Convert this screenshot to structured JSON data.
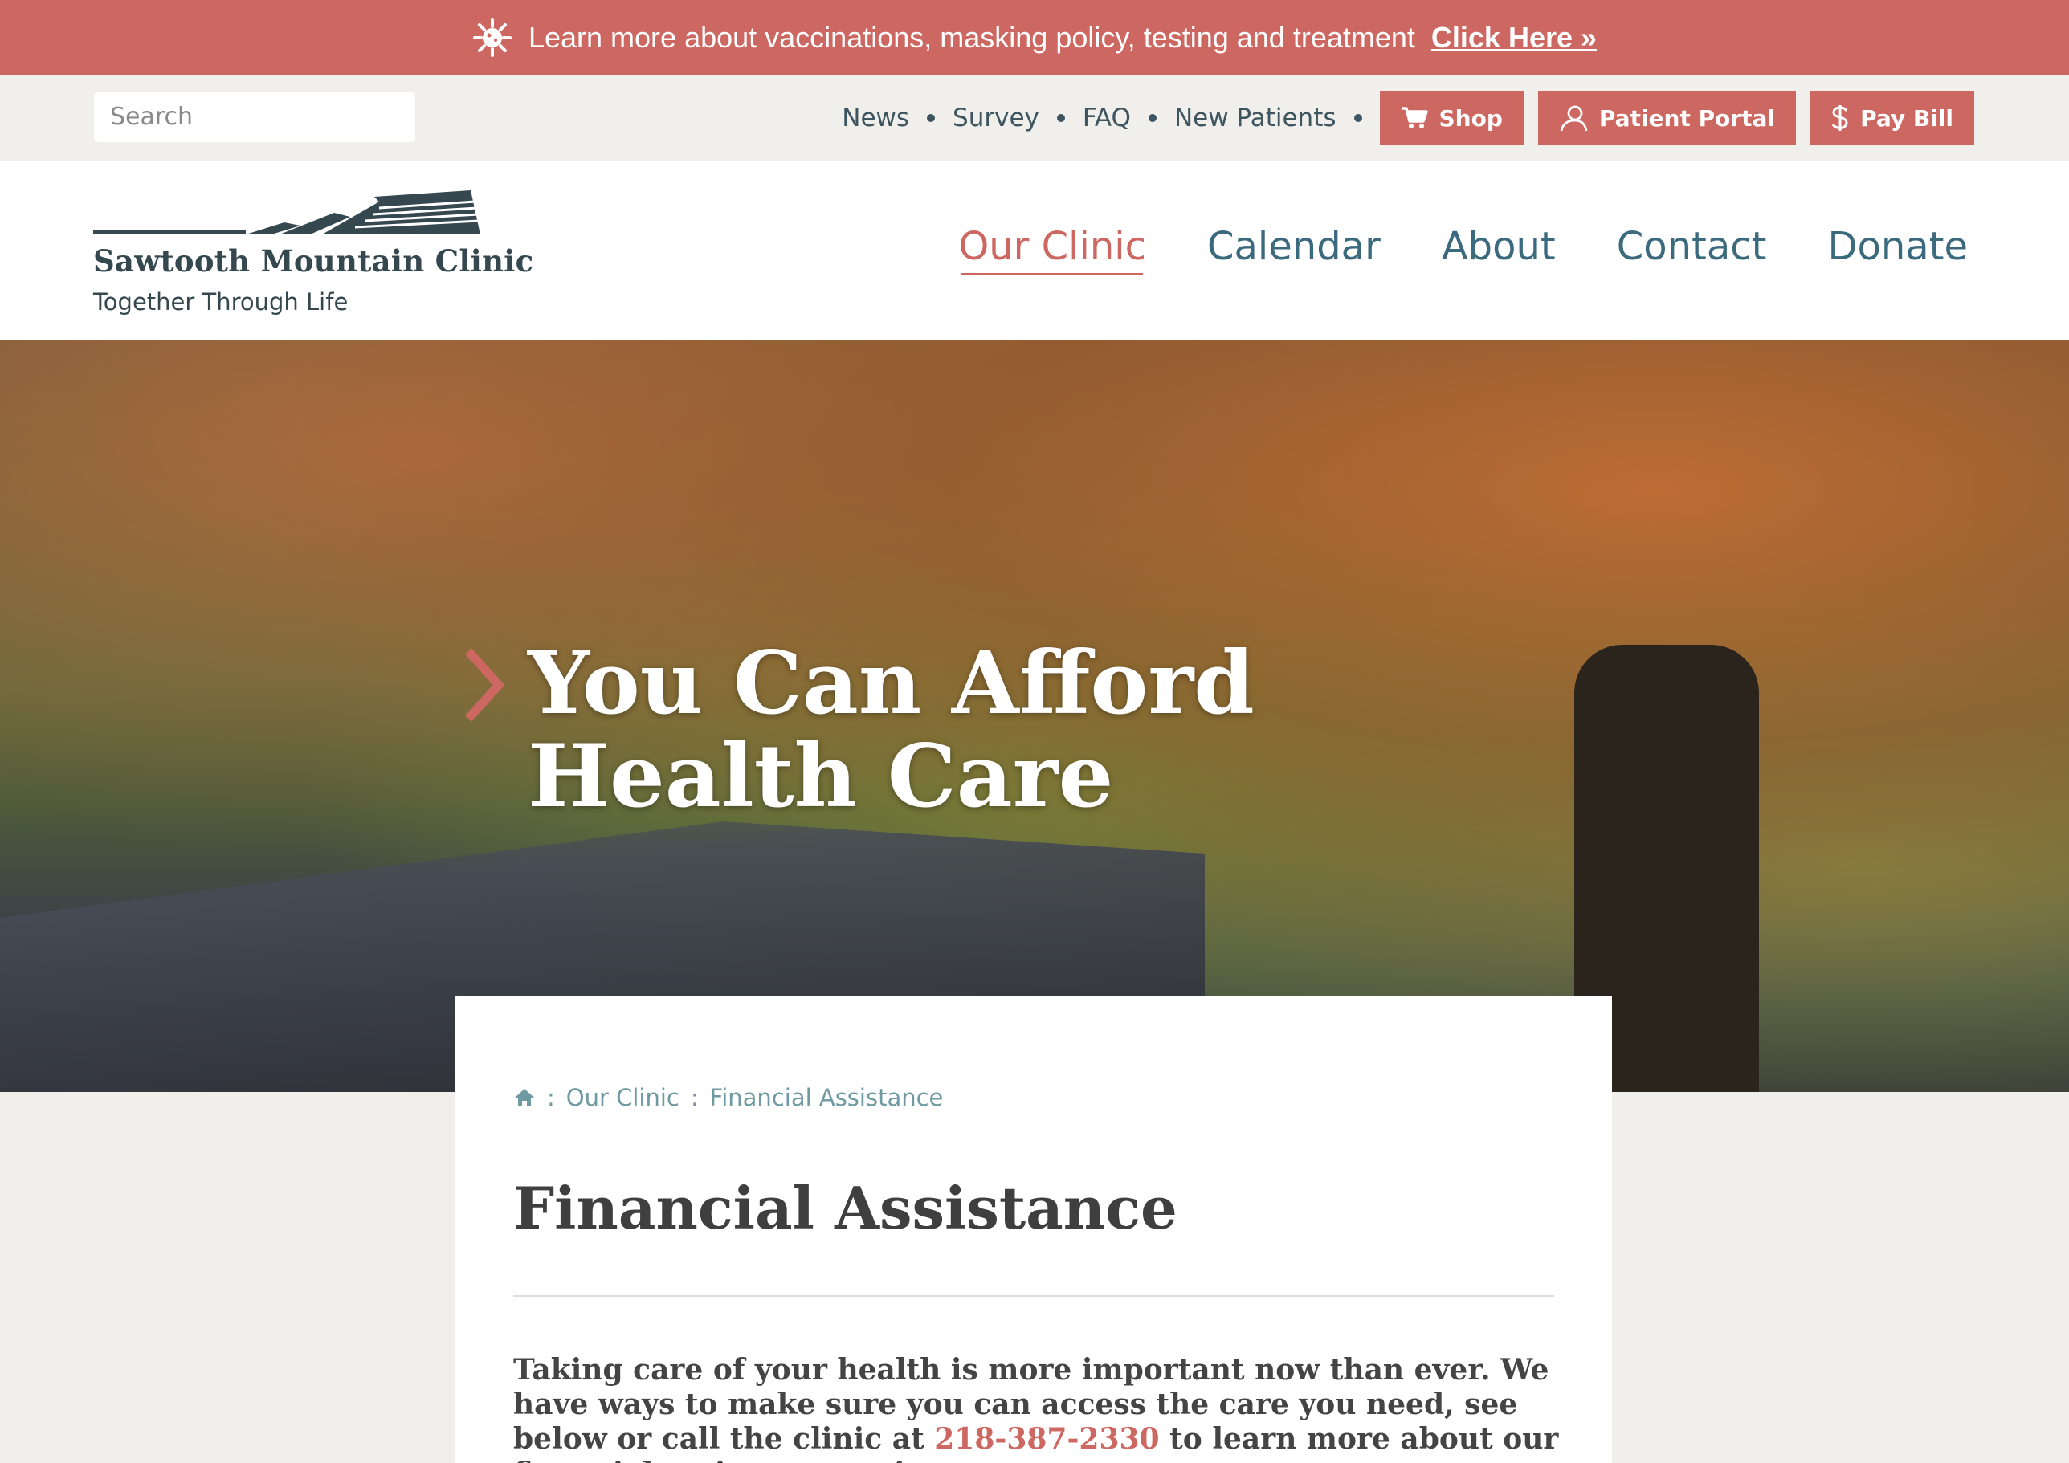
{
  "alert": {
    "text": "Learn more about vaccinations, masking policy, testing and treatment",
    "link_label": "Click Here »"
  },
  "utility": {
    "search_placeholder": "Search",
    "links": [
      "News",
      "Survey",
      "FAQ",
      "New Patients"
    ],
    "buttons": {
      "shop": "Shop",
      "patient_portal": "Patient Portal",
      "pay_bill": "Pay Bill"
    }
  },
  "header": {
    "logo_name": "Sawtooth Mountain Clinic",
    "tagline": "Together Through Life",
    "nav": [
      "Our Clinic",
      "Calendar",
      "About",
      "Contact",
      "Donate"
    ],
    "active_nav": "Our Clinic"
  },
  "hero": {
    "title": "You Can Afford Health Care"
  },
  "content": {
    "breadcrumb": [
      "Our Clinic",
      "Financial Assistance"
    ],
    "title": "Financial Assistance",
    "intro_before": "Taking care of your health is more important now than ever. We have ways to make sure you can access the care you need, see below or call the clinic at ",
    "phone": "218-387-2330",
    "intro_after": " to learn more about our financial assistance options."
  },
  "colors": {
    "accent": "#cd6761",
    "nav_blue": "#3b6a7e",
    "dark_slate": "#35474f",
    "breadcrumb": "#6f9aa2",
    "background": "#f1efeb"
  }
}
